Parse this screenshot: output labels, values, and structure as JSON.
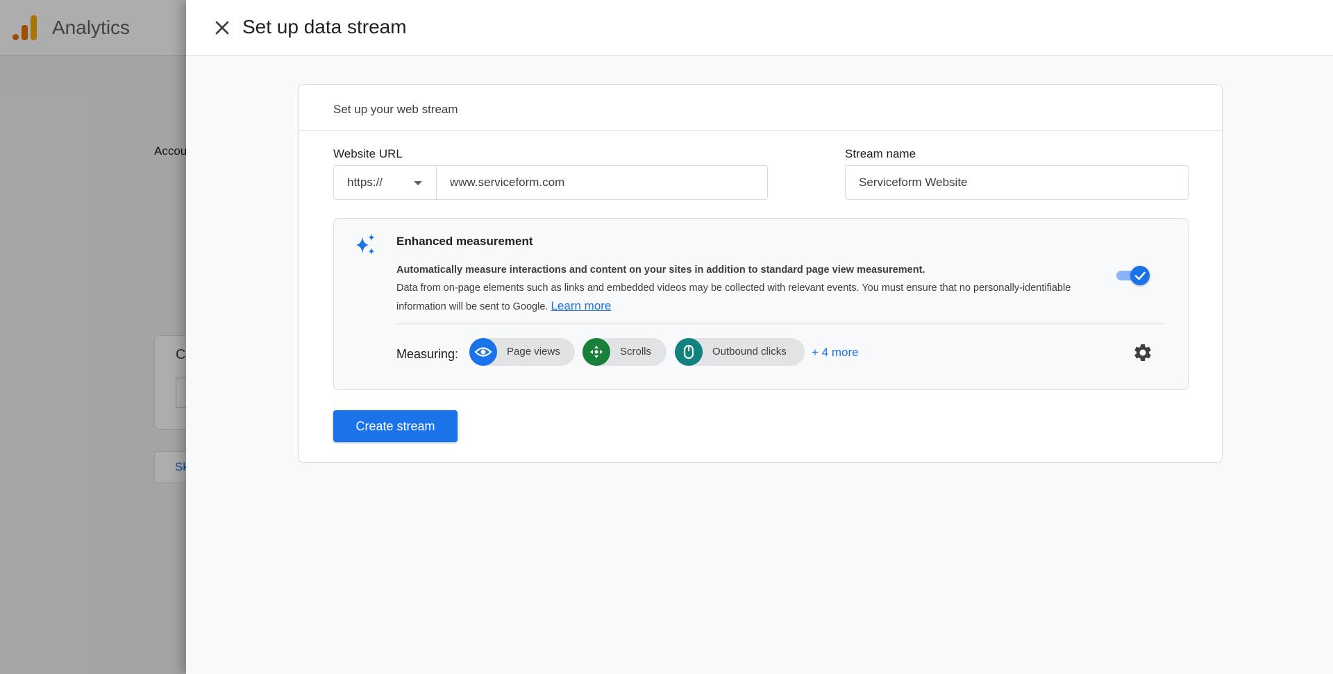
{
  "background": {
    "app_title": "Analytics",
    "account_text_partial": "Accou",
    "card_letter_partial": "C",
    "skip_partial": "Sk"
  },
  "panel": {
    "title": "Set up data stream"
  },
  "card": {
    "header": "Set up your web stream",
    "url_label": "Website URL",
    "protocol_value": "https://",
    "url_value": "www.serviceform.com",
    "name_label": "Stream name",
    "name_value": "Serviceform Website"
  },
  "enhanced": {
    "title": "Enhanced measurement",
    "desc_bold": "Automatically measure interactions and content on your sites in addition to standard page view measurement.",
    "desc": "Data from on-page elements such as links and embedded videos may be collected with relevant events. You must ensure that no personally-identifiable information will be sent to Google.",
    "learn_more": "Learn more",
    "toggle_on": true,
    "measuring_label": "Measuring:",
    "chips": [
      {
        "label": "Page views",
        "icon": "eye-icon",
        "color": "#1a73e8"
      },
      {
        "label": "Scrolls",
        "icon": "scroll-arrows-icon",
        "color": "#188038"
      },
      {
        "label": "Outbound clicks",
        "icon": "mouse-icon",
        "color": "#12827f"
      }
    ],
    "more_link": "+ 4 more"
  },
  "actions": {
    "create_label": "Create stream"
  },
  "colors": {
    "primary": "#1a73e8",
    "analytics_orange": "#e37400",
    "analytics_yellow": "#f9ab00"
  }
}
